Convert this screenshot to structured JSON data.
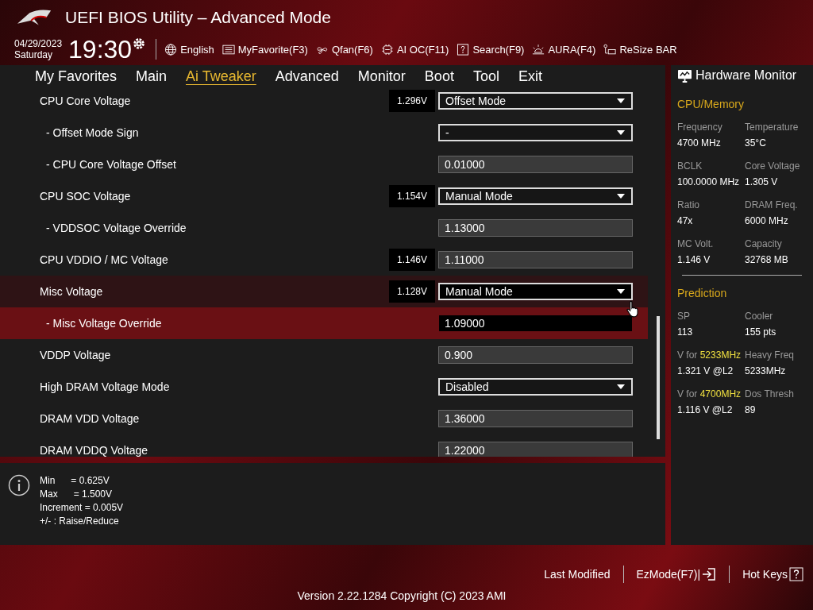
{
  "window": {
    "title": "UEFI BIOS Utility – Advanced Mode"
  },
  "clock": {
    "date": "04/29/2023",
    "day": "Saturday",
    "time": "19:30"
  },
  "toolbar": [
    {
      "kind": "globe",
      "label": "English"
    },
    {
      "kind": "favorite",
      "label": "MyFavorite(F3)"
    },
    {
      "kind": "fan",
      "label": "Qfan(F6)"
    },
    {
      "kind": "chip",
      "label": "AI OC(F11)"
    },
    {
      "kind": "search",
      "label": "Search(F9)"
    },
    {
      "kind": "light",
      "label": "AURA(F4)"
    },
    {
      "kind": "bar",
      "label": "ReSize BAR"
    }
  ],
  "tabs": [
    {
      "label": "My Favorites",
      "selected": false
    },
    {
      "label": "Main",
      "selected": false
    },
    {
      "label": "Ai Tweaker",
      "selected": true
    },
    {
      "label": "Advanced",
      "selected": false
    },
    {
      "label": "Monitor",
      "selected": false
    },
    {
      "label": "Boot",
      "selected": false
    },
    {
      "label": "Tool",
      "selected": false
    },
    {
      "label": "Exit",
      "selected": false
    }
  ],
  "settings": [
    {
      "label": "CPU Core Voltage",
      "reading": "1.296V",
      "kind": "dropdown",
      "value": "Offset Mode",
      "selected": false,
      "hovered": false,
      "children": [
        {
          "label": "- Offset Mode Sign",
          "kind": "dropdown",
          "value": "-",
          "selected": false,
          "hovered": false
        },
        {
          "label": "- CPU Core Voltage Offset",
          "kind": "input",
          "value": "0.01000",
          "selected": false,
          "hovered": false
        }
      ]
    },
    {
      "label": "CPU SOC Voltage",
      "reading": "1.154V",
      "kind": "dropdown",
      "value": "Manual Mode",
      "selected": false,
      "hovered": false,
      "children": [
        {
          "label": "- VDDSOC Voltage Override",
          "kind": "input",
          "value": "1.13000",
          "selected": false,
          "hovered": false
        }
      ]
    },
    {
      "label": "CPU VDDIO / MC Voltage",
      "reading": "1.146V",
      "kind": "input",
      "value": "1.11000",
      "selected": false,
      "hovered": false
    },
    {
      "label": "Misc Voltage",
      "reading": "1.128V",
      "kind": "dropdown",
      "value": "Manual Mode",
      "selected": false,
      "hovered": true,
      "children": [
        {
          "label": "- Misc Voltage Override",
          "kind": "input",
          "value": "1.09000",
          "selected": true,
          "hovered": false
        }
      ]
    },
    {
      "label": "VDDP Voltage",
      "kind": "input",
      "value": "0.900",
      "selected": false,
      "hovered": false
    },
    {
      "label": "High DRAM Voltage Mode",
      "kind": "dropdown",
      "value": "Disabled",
      "selected": false,
      "hovered": false
    },
    {
      "label": "DRAM VDD Voltage",
      "kind": "input",
      "value": "1.36000",
      "selected": false,
      "hovered": false
    },
    {
      "label": "DRAM VDDQ Voltage",
      "kind": "input",
      "value": "1.22000",
      "selected": false,
      "hovered": false
    }
  ],
  "help": [
    "Min      = 0.625V",
    "Max      = 1.500V",
    "Increment = 0.005V",
    "+/- : Raise/Reduce"
  ],
  "hardware_monitor": {
    "title": "Hardware Monitor",
    "sections": [
      {
        "title": "CPU/Memory",
        "items": [
          {
            "label": "Frequency",
            "value": "4700 MHz"
          },
          {
            "label": "Temperature",
            "value": "35°C"
          },
          {
            "label": "BCLK",
            "value": "100.0000 MHz"
          },
          {
            "label": "Core Voltage",
            "value": "1.305 V"
          },
          {
            "label": "Ratio",
            "value": "47x"
          },
          {
            "label": "DRAM Freq.",
            "value": "6000 MHz"
          },
          {
            "label": "MC Volt.",
            "value": "1.146 V"
          },
          {
            "label": "Capacity",
            "value": "32768 MB"
          }
        ]
      },
      {
        "title": "Prediction",
        "items": [
          {
            "label": "SP",
            "value": "113"
          },
          {
            "label": "Cooler",
            "value": "155 pts"
          },
          {
            "label": "V for **5233MHz**",
            "value": "1.321 V @L2"
          },
          {
            "label": "Heavy Freq",
            "value": "5233MHz"
          },
          {
            "label": "V for **4700MHz**",
            "value": "1.116 V @L2"
          },
          {
            "label": "Dos Thresh",
            "value": "89"
          }
        ]
      }
    ]
  },
  "footer": {
    "buttons": [
      {
        "kind": "plain",
        "label": "Last Modified"
      },
      {
        "kind": "ezmode",
        "label": "EzMode(F7)|"
      },
      {
        "kind": "hotkeys",
        "label": "Hot Keys"
      }
    ],
    "version": "Version 2.22.1284 Copyright (C) 2023 AMI"
  }
}
